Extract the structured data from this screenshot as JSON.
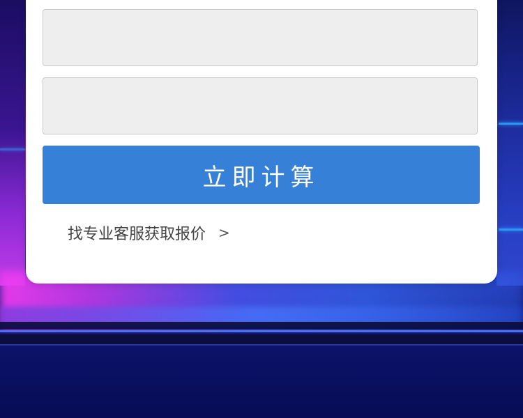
{
  "form": {
    "field_1": {
      "value": "",
      "placeholder": ""
    },
    "field_2": {
      "value": "",
      "placeholder": ""
    },
    "calculate_label": "立即计算",
    "quote_link_label": "找专业客服获取报价",
    "quote_link_arrow": ">"
  },
  "colors": {
    "button": "#3680d8",
    "field_bg": "#eeeeee",
    "card_bg": "#ffffff",
    "link_text": "#444444"
  }
}
